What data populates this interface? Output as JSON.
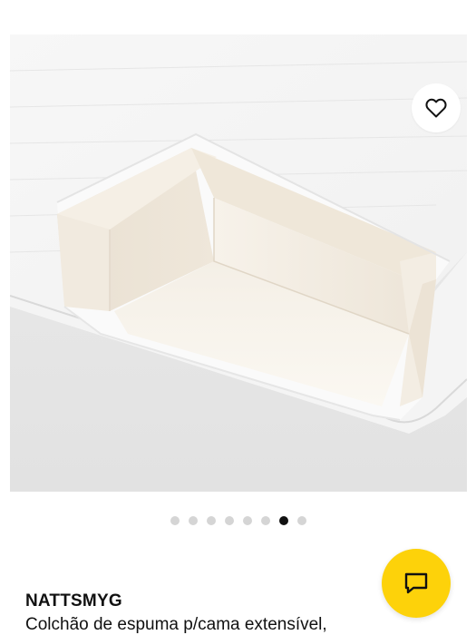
{
  "gallery": {
    "image_name": "mattress-cutaway-image",
    "dot_count": 8,
    "active_index": 6
  },
  "favorite": {
    "icon": "heart-icon"
  },
  "product": {
    "name": "NATTSMYG",
    "description": "Colchão de espuma p/cama extensível,"
  },
  "chat": {
    "icon": "chat-icon",
    "color": "#fdd20a"
  }
}
